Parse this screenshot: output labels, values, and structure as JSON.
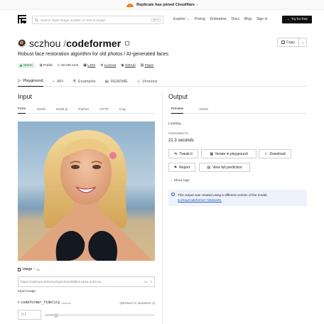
{
  "banner": {
    "text": "Replicate has joined Cloudflare",
    "arrow": "›"
  },
  "nav": {
    "search_placeholder": "Search 'flash image models' or 'text to image'",
    "search_shortcut": "ctrl+k",
    "explore": "Explore",
    "links": [
      "Pricing",
      "Enterprise",
      "Docs",
      "Blog",
      "Sign in"
    ],
    "try_label": "Try for free"
  },
  "model": {
    "owner": "sczhou",
    "slash": "/",
    "name": "codeformer",
    "description": "Robust face restoration algorithm for old photos / AI-generated faces",
    "copy_label": "Copy"
  },
  "meta": {
    "status": "Warm",
    "visibility": "Public",
    "runs": "50.4M runs",
    "gpu": "L40S",
    "license": "License",
    "github": "GitHub",
    "paper": "Paper"
  },
  "tabs": [
    "Playground",
    "API",
    "Examples",
    "README",
    "Versions"
  ],
  "input": {
    "title": "Input",
    "subtabs": [
      "Form",
      "JSON",
      "Node.js",
      "Python",
      "HTTP",
      "Cog"
    ],
    "image_label": "image",
    "image_required": "*",
    "image_type": "file",
    "image_value": "https://replicate.delivery/mgxm/a11098b0-a18a-4c02-a1…",
    "image_help": "Input image",
    "fidelity_label": "codeformer_fidelity",
    "fidelity_type": "number",
    "fidelity_range": "(minimum: 0, maximum: 1)",
    "fidelity_placeholder": "0.1",
    "fidelity_level": 0.1
  },
  "output": {
    "title": "Output",
    "subtabs": [
      "Preview",
      "JSON"
    ],
    "loading": "Loading...",
    "generated_in": "Generated in",
    "seconds": "21.3 seconds",
    "buttons": [
      "Tweak it",
      "Iterate in playground",
      "Download",
      "Report",
      "View full prediction"
    ],
    "show_logs": "Show logs",
    "note_text": "This output was created using a different version of the model,",
    "note_link": "sczhou/codeformer:7de2ea26."
  },
  "colors": {
    "accent": "#111111",
    "warm_bg": "#dff3e4",
    "note_bg": "#eef3fb",
    "cloudflare": "#f48120"
  }
}
